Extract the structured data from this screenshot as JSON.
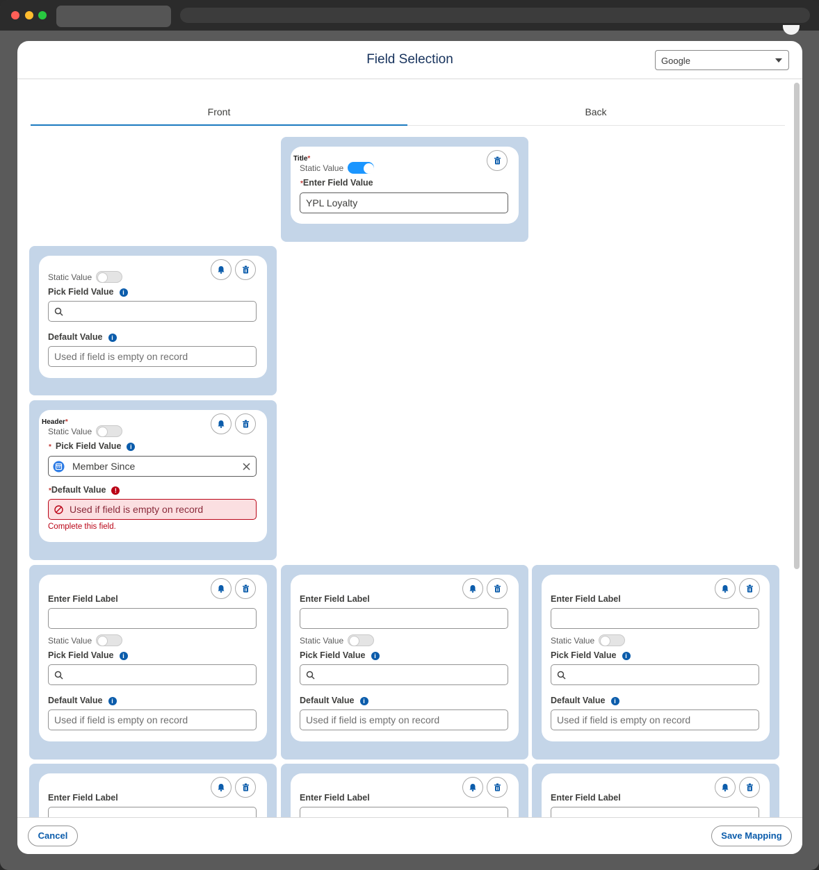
{
  "modal": {
    "title": "Field Selection",
    "select_value": "Google",
    "tabs": [
      "Front",
      "Back"
    ],
    "cancel_label": "Cancel",
    "save_label": "Save Mapping"
  },
  "labels": {
    "title": "Title",
    "header": "Header",
    "static_value": "Static Value",
    "enter_field_value": "Enter Field Value",
    "pick_field_value": "Pick Field Value",
    "default_value": "Default Value",
    "enter_field_label": "Enter Field Label",
    "default_placeholder": "Used if field is empty on record",
    "required_mark": "*",
    "complete_field_error": "Complete this field."
  },
  "title_card": {
    "field_value": "YPL Loyalty",
    "static_on": true
  },
  "header_card": {
    "picked_value": "Member Since"
  },
  "colors": {
    "accent": "#0b5cab",
    "slot_bg": "#c4d5e8",
    "error": "#ba0517"
  }
}
